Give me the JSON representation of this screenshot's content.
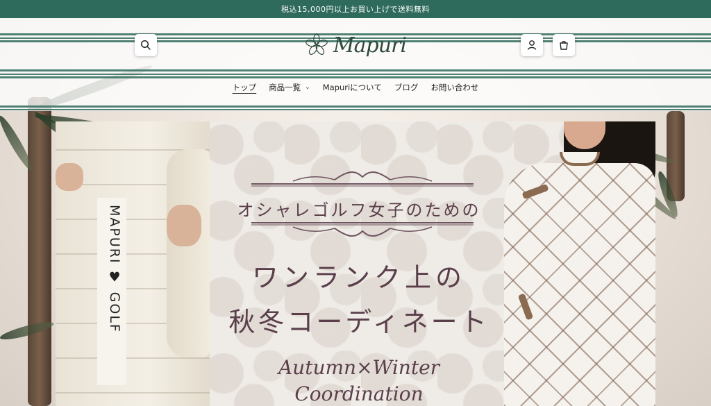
{
  "announcement": {
    "text": "税込15,000円以上お買い上げで送料無料"
  },
  "header": {
    "logo_text": "Mapuri",
    "search_icon": "search-icon",
    "account_icon": "user-icon",
    "cart_icon": "cart-icon"
  },
  "nav": {
    "items": [
      {
        "label": "トップ",
        "active": true
      },
      {
        "label": "商品一覧",
        "has_dropdown": true
      },
      {
        "label": "Mapuriについて"
      },
      {
        "label": "ブログ"
      },
      {
        "label": "お問い合わせ"
      }
    ]
  },
  "hero": {
    "tagline": "オシャレゴルフ女子のための",
    "headline_line1": "ワンランク上の",
    "headline_line2": "秋冬コーディネート",
    "script_line1": "Autumn×Winter",
    "script_line2": "Coordination",
    "jacket_text": "MAPURI ♥ GOLF"
  },
  "colors": {
    "brand_green": "#2f6b5c",
    "copy_mauve": "#5a3f4b"
  }
}
